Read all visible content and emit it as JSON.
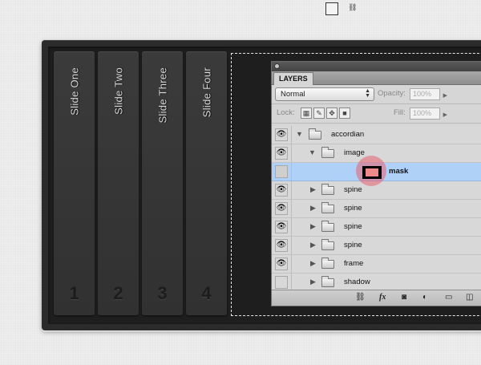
{
  "slides": [
    {
      "label": "Slide One",
      "number": "1"
    },
    {
      "label": "Slide Two",
      "number": "2"
    },
    {
      "label": "Slide Three",
      "number": "3"
    },
    {
      "label": "Slide Four",
      "number": "4"
    }
  ],
  "layers_panel": {
    "tab": "LAYERS",
    "blend_mode": "Normal",
    "opacity_label": "Opacity:",
    "opacity_value": "100%",
    "lock_label": "Lock:",
    "fill_label": "Fill:",
    "fill_value": "100%",
    "layers": [
      {
        "name": "accordian",
        "visible": true
      },
      {
        "name": "image",
        "visible": true
      },
      {
        "name": "mask",
        "visible": false,
        "selected": true
      },
      {
        "name": "spine",
        "visible": true
      },
      {
        "name": "spine",
        "visible": true
      },
      {
        "name": "spine",
        "visible": true
      },
      {
        "name": "spine",
        "visible": true
      },
      {
        "name": "frame",
        "visible": true
      },
      {
        "name": "shadow",
        "visible": false
      }
    ],
    "bottom_icons": [
      "link-icon",
      "fx-icon",
      "add-mask-icon",
      "adjustment-icon",
      "new-group-icon",
      "new-layer-icon"
    ],
    "fx_label": "fx"
  },
  "colors": {
    "selected_row": "#afd0f7",
    "mask_highlight": "#e86070",
    "slide_bg": "#353535"
  }
}
